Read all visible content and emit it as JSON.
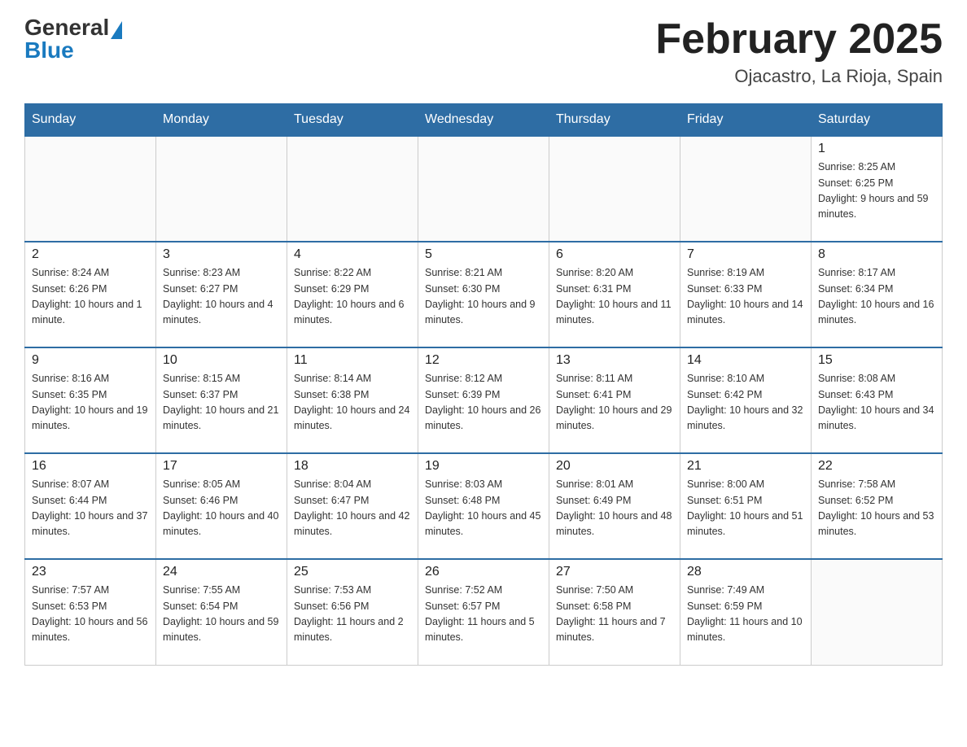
{
  "header": {
    "logo_general": "General",
    "logo_blue": "Blue",
    "month_title": "February 2025",
    "location": "Ojacastro, La Rioja, Spain"
  },
  "weekdays": [
    "Sunday",
    "Monday",
    "Tuesday",
    "Wednesday",
    "Thursday",
    "Friday",
    "Saturday"
  ],
  "weeks": [
    [
      {
        "day": "",
        "info": ""
      },
      {
        "day": "",
        "info": ""
      },
      {
        "day": "",
        "info": ""
      },
      {
        "day": "",
        "info": ""
      },
      {
        "day": "",
        "info": ""
      },
      {
        "day": "",
        "info": ""
      },
      {
        "day": "1",
        "info": "Sunrise: 8:25 AM\nSunset: 6:25 PM\nDaylight: 9 hours and 59 minutes."
      }
    ],
    [
      {
        "day": "2",
        "info": "Sunrise: 8:24 AM\nSunset: 6:26 PM\nDaylight: 10 hours and 1 minute."
      },
      {
        "day": "3",
        "info": "Sunrise: 8:23 AM\nSunset: 6:27 PM\nDaylight: 10 hours and 4 minutes."
      },
      {
        "day": "4",
        "info": "Sunrise: 8:22 AM\nSunset: 6:29 PM\nDaylight: 10 hours and 6 minutes."
      },
      {
        "day": "5",
        "info": "Sunrise: 8:21 AM\nSunset: 6:30 PM\nDaylight: 10 hours and 9 minutes."
      },
      {
        "day": "6",
        "info": "Sunrise: 8:20 AM\nSunset: 6:31 PM\nDaylight: 10 hours and 11 minutes."
      },
      {
        "day": "7",
        "info": "Sunrise: 8:19 AM\nSunset: 6:33 PM\nDaylight: 10 hours and 14 minutes."
      },
      {
        "day": "8",
        "info": "Sunrise: 8:17 AM\nSunset: 6:34 PM\nDaylight: 10 hours and 16 minutes."
      }
    ],
    [
      {
        "day": "9",
        "info": "Sunrise: 8:16 AM\nSunset: 6:35 PM\nDaylight: 10 hours and 19 minutes."
      },
      {
        "day": "10",
        "info": "Sunrise: 8:15 AM\nSunset: 6:37 PM\nDaylight: 10 hours and 21 minutes."
      },
      {
        "day": "11",
        "info": "Sunrise: 8:14 AM\nSunset: 6:38 PM\nDaylight: 10 hours and 24 minutes."
      },
      {
        "day": "12",
        "info": "Sunrise: 8:12 AM\nSunset: 6:39 PM\nDaylight: 10 hours and 26 minutes."
      },
      {
        "day": "13",
        "info": "Sunrise: 8:11 AM\nSunset: 6:41 PM\nDaylight: 10 hours and 29 minutes."
      },
      {
        "day": "14",
        "info": "Sunrise: 8:10 AM\nSunset: 6:42 PM\nDaylight: 10 hours and 32 minutes."
      },
      {
        "day": "15",
        "info": "Sunrise: 8:08 AM\nSunset: 6:43 PM\nDaylight: 10 hours and 34 minutes."
      }
    ],
    [
      {
        "day": "16",
        "info": "Sunrise: 8:07 AM\nSunset: 6:44 PM\nDaylight: 10 hours and 37 minutes."
      },
      {
        "day": "17",
        "info": "Sunrise: 8:05 AM\nSunset: 6:46 PM\nDaylight: 10 hours and 40 minutes."
      },
      {
        "day": "18",
        "info": "Sunrise: 8:04 AM\nSunset: 6:47 PM\nDaylight: 10 hours and 42 minutes."
      },
      {
        "day": "19",
        "info": "Sunrise: 8:03 AM\nSunset: 6:48 PM\nDaylight: 10 hours and 45 minutes."
      },
      {
        "day": "20",
        "info": "Sunrise: 8:01 AM\nSunset: 6:49 PM\nDaylight: 10 hours and 48 minutes."
      },
      {
        "day": "21",
        "info": "Sunrise: 8:00 AM\nSunset: 6:51 PM\nDaylight: 10 hours and 51 minutes."
      },
      {
        "day": "22",
        "info": "Sunrise: 7:58 AM\nSunset: 6:52 PM\nDaylight: 10 hours and 53 minutes."
      }
    ],
    [
      {
        "day": "23",
        "info": "Sunrise: 7:57 AM\nSunset: 6:53 PM\nDaylight: 10 hours and 56 minutes."
      },
      {
        "day": "24",
        "info": "Sunrise: 7:55 AM\nSunset: 6:54 PM\nDaylight: 10 hours and 59 minutes."
      },
      {
        "day": "25",
        "info": "Sunrise: 7:53 AM\nSunset: 6:56 PM\nDaylight: 11 hours and 2 minutes."
      },
      {
        "day": "26",
        "info": "Sunrise: 7:52 AM\nSunset: 6:57 PM\nDaylight: 11 hours and 5 minutes."
      },
      {
        "day": "27",
        "info": "Sunrise: 7:50 AM\nSunset: 6:58 PM\nDaylight: 11 hours and 7 minutes."
      },
      {
        "day": "28",
        "info": "Sunrise: 7:49 AM\nSunset: 6:59 PM\nDaylight: 11 hours and 10 minutes."
      },
      {
        "day": "",
        "info": ""
      }
    ]
  ]
}
